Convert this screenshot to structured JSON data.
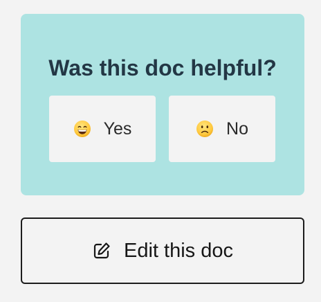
{
  "feedback": {
    "title": "Was this doc helpful?",
    "yes_label": "Yes",
    "no_label": "No",
    "yes_icon": "grinning-face-icon",
    "no_icon": "slightly-frowning-face-icon",
    "background_color": "#ade3e2",
    "title_color": "#233745"
  },
  "edit": {
    "label": "Edit this doc",
    "icon": "edit-pencil-icon"
  }
}
